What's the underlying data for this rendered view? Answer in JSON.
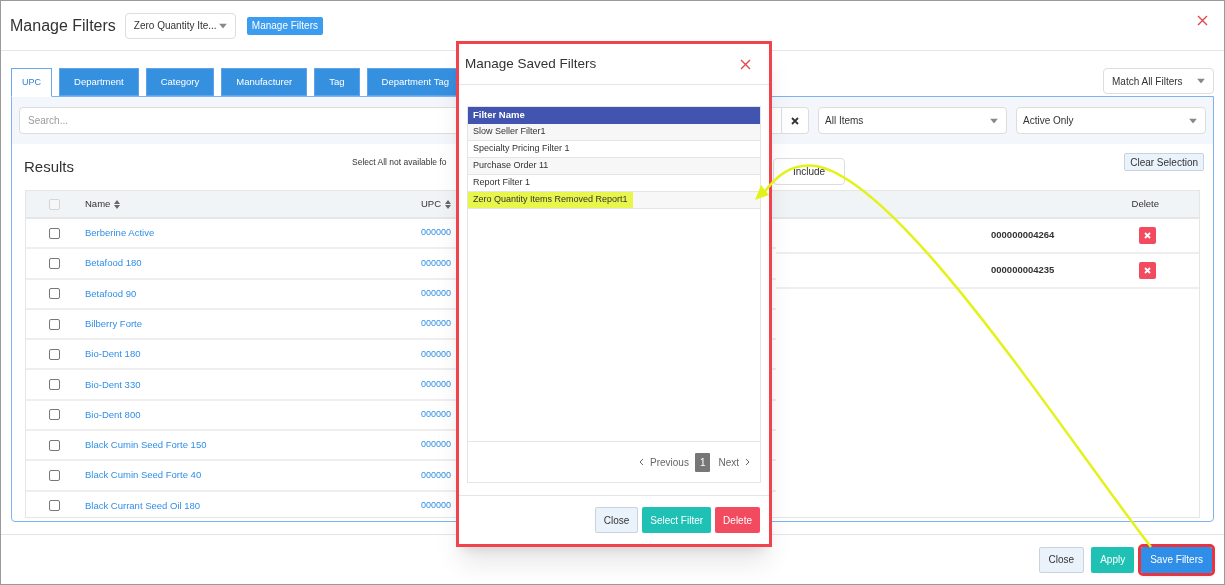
{
  "header": {
    "title": "Manage Filters",
    "saved_filter_select": "Zero Quantity Ite...",
    "manage_button": "Manage Filters"
  },
  "tabs": [
    {
      "label": "UPC",
      "selected": true
    },
    {
      "label": "Department",
      "selected": false
    },
    {
      "label": "Category",
      "selected": false
    },
    {
      "label": "Manufacturer",
      "selected": false
    },
    {
      "label": "Tag",
      "selected": false
    },
    {
      "label": "Department Tag",
      "selected": false
    }
  ],
  "match_select": "Match All Filters",
  "filter_bar": {
    "search_placeholder": "Search...",
    "scope_select": "All Items",
    "status_select": "Active Only"
  },
  "results": {
    "title": "Results",
    "note": "Select All not available fo",
    "include_button": "Include",
    "clear_button": "Clear Selection"
  },
  "table": {
    "select_all_checked": false,
    "columns": [
      "Name",
      "UPC"
    ],
    "delete_column": "Delete",
    "rows": [
      {
        "name": "Berberine Active",
        "upc": "000000",
        "checked": false
      },
      {
        "name": "Betafood 180",
        "upc": "000000",
        "checked": false
      },
      {
        "name": "Betafood 90",
        "upc": "000000",
        "checked": false
      },
      {
        "name": "Bilberry Forte",
        "upc": "000000",
        "checked": false
      },
      {
        "name": "Bio-Dent 180",
        "upc": "000000",
        "checked": false
      },
      {
        "name": "Bio-Dent 330",
        "upc": "000000",
        "checked": false
      },
      {
        "name": "Bio-Dent 800",
        "upc": "000000",
        "checked": false
      },
      {
        "name": "Black Cumin Seed Forte 150",
        "upc": "000000",
        "checked": false
      },
      {
        "name": "Black Cumin Seed Forte 40",
        "upc": "000000",
        "checked": false
      },
      {
        "name": "Black Currant Seed Oil 180",
        "upc": "000000",
        "checked": false
      }
    ],
    "selected_items": [
      {
        "upc": "000000004264"
      },
      {
        "upc": "000000004235"
      }
    ]
  },
  "footer_buttons": [
    {
      "label": "Close",
      "kind": "default"
    },
    {
      "label": "Apply",
      "kind": "success"
    },
    {
      "label": "Save Filters",
      "kind": "primary",
      "highlighted": true
    }
  ],
  "dialog": {
    "title": "Manage Saved Filters",
    "column": "Filter Name",
    "filters": [
      {
        "name": "Slow Seller Filter1",
        "highlighted": false
      },
      {
        "name": "Specialty Pricing Filter 1",
        "highlighted": false
      },
      {
        "name": "Purchase Order 11",
        "highlighted": false
      },
      {
        "name": "Report Filter 1",
        "highlighted": false
      },
      {
        "name": "Zero Quantity Items Removed Report1",
        "highlighted": true
      }
    ],
    "pagination": {
      "previous": "Previous",
      "page": "1",
      "next": "Next"
    },
    "buttons": [
      {
        "label": "Close",
        "kind": "default"
      },
      {
        "label": "Select Filter",
        "kind": "success"
      },
      {
        "label": "Delete",
        "kind": "danger"
      }
    ]
  }
}
